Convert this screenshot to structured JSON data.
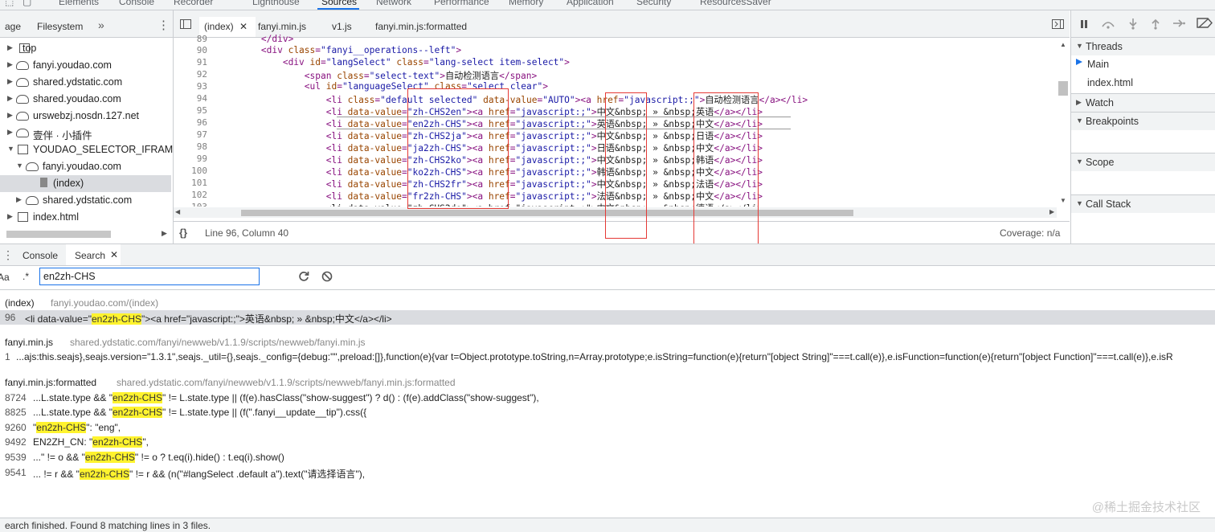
{
  "devtools_tabs": [
    "Elements",
    "Console",
    "Recorder",
    "Lighthouse",
    "Sources",
    "Network",
    "Performance",
    "Memory",
    "Application",
    "Security",
    "ResourcesSaver"
  ],
  "navigator": {
    "tabs": [
      "age",
      "Filesystem"
    ],
    "tree": [
      {
        "label": "top",
        "icon": "frame-icon"
      },
      {
        "label": "fanyi.youdao.com",
        "icon": "cloud-icon"
      },
      {
        "label": "shared.ydstatic.com",
        "icon": "cloud-icon"
      },
      {
        "label": "shared.youdao.com",
        "icon": "cloud-icon"
      },
      {
        "label": "urswebzj.nosdn.127.net",
        "icon": "cloud-icon"
      },
      {
        "label": "壹伴 · 小插件",
        "icon": "cloud-icon"
      },
      {
        "label": "YOUDAO_SELECTOR_IFRAME (fa",
        "icon": "frame-icon"
      },
      {
        "label": "fanyi.youdao.com",
        "icon": "cloud-icon"
      },
      {
        "label": "(index)",
        "icon": "file-icon"
      },
      {
        "label": "shared.ydstatic.com",
        "icon": "cloud-icon"
      },
      {
        "label": "index.html",
        "icon": "frame-icon"
      }
    ]
  },
  "editor": {
    "tabs": [
      "(index)",
      "fanyi.min.js",
      "v1.js",
      "fanyi.min.js:formatted"
    ],
    "line_numbers": [
      "89",
      "90",
      "91",
      "92",
      "93",
      "94",
      "95",
      "96",
      "97",
      "98",
      "99",
      "100",
      "101",
      "102",
      "103"
    ],
    "status_position": "Line 96, Column 40",
    "coverage": "Coverage: n/a",
    "format_icon_text": "{}"
  },
  "sidebar": {
    "sections": [
      "Threads",
      "Watch",
      "Breakpoints",
      "Scope",
      "Call Stack"
    ],
    "threads": [
      "Main",
      "index.html"
    ]
  },
  "drawer": {
    "tabs": [
      "Console",
      "Search"
    ],
    "search_query": "en2zh-CHS",
    "case_toggle": "Aa",
    "regex_toggle": ".*",
    "results": {
      "f1_name": "(index)",
      "f1_path": "fanyi.youdao.com/(index)",
      "f1_l1_num": "96",
      "f1_l1_pre": "<li data-value=\"",
      "f1_l1_match": "en2zh-CHS",
      "f1_l1_post": "\"><a href=\"javascript:;\">英语&nbsp; » &nbsp;中文</a></li>",
      "f2_name": "fanyi.min.js",
      "f2_path": "shared.ydstatic.com/fanyi/newweb/v1.1.9/scripts/newweb/fanyi.min.js",
      "f2_l1_num": "1",
      "f2_l1_text": "...ajs:this.seajs},seajs.version=\"1.3.1\",seajs._util={},seajs._config={debug:\"\",preload:[]},function(e){var t=Object.prototype.toString,n=Array.prototype;e.isString=function(e){return\"[object String]\"===t.call(e)},e.isFunction=function(e){return\"[object Function]\"===t.call(e)},e.isR",
      "f3_name": "fanyi.min.js:formatted",
      "f3_path": "shared.ydstatic.com/fanyi/newweb/v1.1.9/scripts/newweb/fanyi.min.js:formatted",
      "f3_l1_num": "8724",
      "f3_l1_pre": "...L.state.type && \"",
      "f3_l1_match": "en2zh-CHS",
      "f3_l1_post": "\" != L.state.type || (f(e).hasClass(\"show-suggest\") ? d() : (f(e).addClass(\"show-suggest\"),",
      "f3_l2_num": "8825",
      "f3_l2_pre": "...L.state.type && \"",
      "f3_l2_match": "en2zh-CHS",
      "f3_l2_post": "\" != L.state.type || (f(\".fanyi__update__tip\").css({",
      "f3_l3_num": "9260",
      "f3_l3_pre": "\"",
      "f3_l3_match": "en2zh-CHS",
      "f3_l3_post": "\": \"eng\",",
      "f3_l4_num": "9492",
      "f3_l4_pre": "EN2ZH_CN: \"",
      "f3_l4_match": "en2zh-CHS",
      "f3_l4_post": "\",",
      "f3_l5_num": "9539",
      "f3_l5_pre": "...\" != o && \"",
      "f3_l5_match": "en2zh-CHS",
      "f3_l5_post": "\" != o ? t.eq(i).hide() : t.eq(i).show()",
      "f3_l6_num": "9541",
      "f3_l6_pre": "... != r && \"",
      "f3_l6_match": "en2zh-CHS",
      "f3_l6_post": "\" != r && (n(\"#langSelect .default a\").text(\"请选择语言\"),"
    },
    "status": "earch finished.  Found 8 matching lines in 3 files."
  },
  "watermark": "@稀土掘金技术社区",
  "colors": {
    "accent": "#1a73e8",
    "highlight": "#fff32e",
    "annotation": "#e53935",
    "tag": "#881280",
    "attr_name": "#994500",
    "attr_value": "#1a1aa6"
  }
}
